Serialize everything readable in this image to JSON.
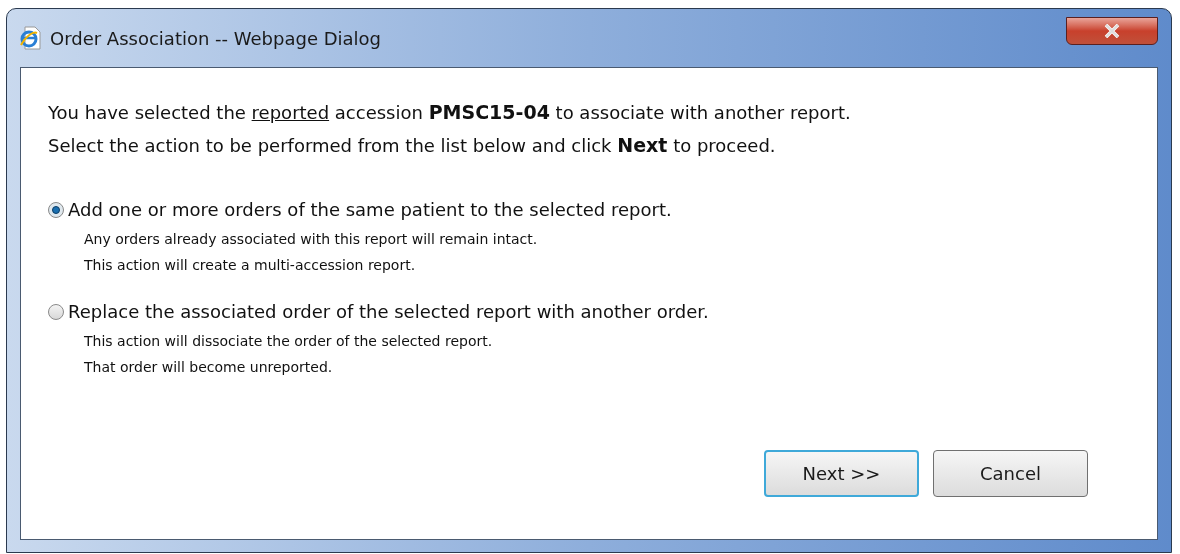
{
  "window": {
    "title": "Order Association -- Webpage Dialog"
  },
  "intro": [
    {
      "segments": [
        {
          "text": "You have selected the ",
          "kind": "plain"
        },
        {
          "text": "reported",
          "kind": "underline"
        },
        {
          "text": " accession ",
          "kind": "plain"
        },
        {
          "text": "PMSC15-04",
          "kind": "bold"
        },
        {
          "text": " to associate with another report.",
          "kind": "plain"
        }
      ]
    },
    {
      "segments": [
        {
          "text": "Select the action to be performed from the list below and click ",
          "kind": "plain"
        },
        {
          "text": "Next",
          "kind": "bold"
        },
        {
          "text": " to proceed.",
          "kind": "plain"
        }
      ]
    }
  ],
  "options": [
    {
      "label": "Add one or more orders of the same patient to the selected report.",
      "selected": true,
      "notes": [
        "Any orders already associated with this report will remain intact.",
        "This action will create a multi-accession report."
      ]
    },
    {
      "label": "Replace the associated order of the selected report with another order.",
      "selected": false,
      "notes": [
        "This action will dissociate the order of the selected report.",
        "That order will become unreported."
      ]
    }
  ],
  "buttons": [
    {
      "label": "Next >>",
      "default": true
    },
    {
      "label": "Cancel",
      "default": false
    }
  ]
}
